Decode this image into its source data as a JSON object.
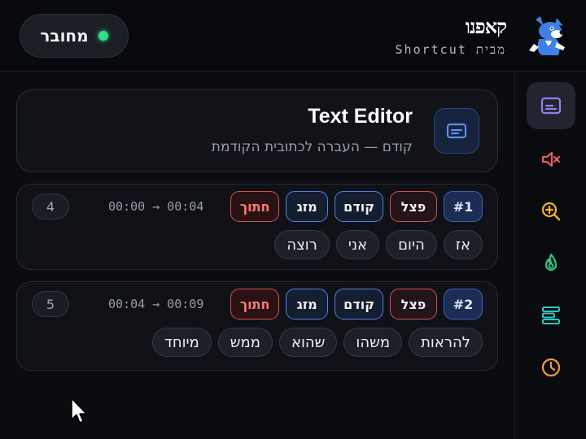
{
  "header": {
    "status_label": "מחובר",
    "status_color": "#2ee08a",
    "brand_logo": "קאפנו",
    "brand_sub": "מבית Shortcut"
  },
  "sidebar": {
    "items": [
      {
        "icon": "subtitles-icon",
        "color": "#8b82f0",
        "active": true
      },
      {
        "icon": "mute-icon",
        "color": "#e0625a",
        "active": false
      },
      {
        "icon": "zoom-in-icon",
        "color": "#f0b429",
        "active": false
      },
      {
        "icon": "flame-icon",
        "color": "#2ec27e",
        "active": false
      },
      {
        "icon": "bars-align-icon",
        "color": "#2fc6c6",
        "active": false
      },
      {
        "icon": "clock-icon",
        "color": "#f0a030",
        "active": false
      }
    ]
  },
  "editor": {
    "title": "Text Editor",
    "subtitle": "קודם — העברה לכתובית הקודמת",
    "icon": "subtitles-icon"
  },
  "segments": [
    {
      "index": "#1",
      "actions": {
        "split": "פצל",
        "prev": "קודם",
        "merge": "מזג",
        "cut": "חתוך"
      },
      "time_start": "00:00",
      "time_end": "00:04",
      "arrow": "→",
      "count": "4",
      "words": [
        "אז",
        "היום",
        "אני",
        "רוצה"
      ]
    },
    {
      "index": "#2",
      "actions": {
        "split": "פצל",
        "prev": "קודם",
        "merge": "מזג",
        "cut": "חתוך"
      },
      "time_start": "00:04",
      "time_end": "00:09",
      "arrow": "→",
      "count": "5",
      "words": [
        "להראות",
        "משהו",
        "שהוא",
        "ממש",
        "מיוחד"
      ]
    }
  ]
}
